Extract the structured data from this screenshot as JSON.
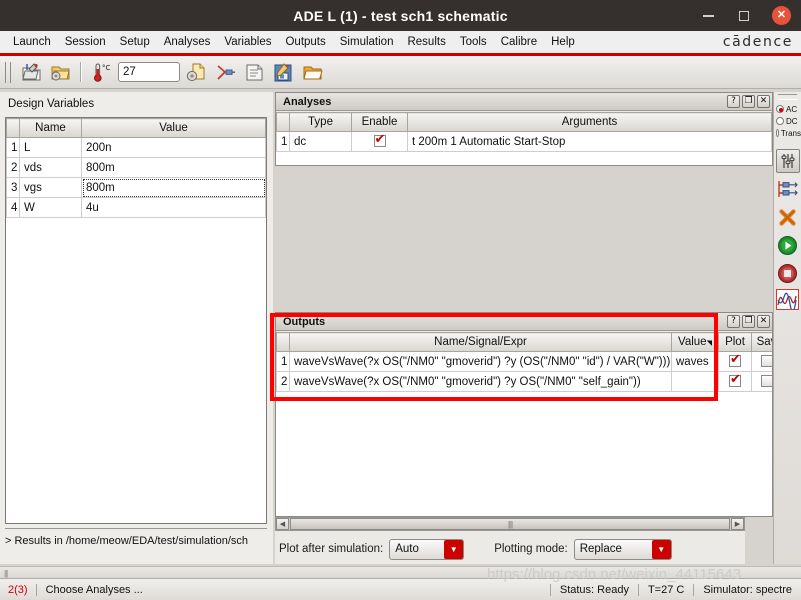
{
  "window": {
    "title": "ADE L (1) - test sch1 schematic",
    "minimize_label": "Minimize",
    "maximize_label": "Maximize",
    "close_label": "✕"
  },
  "menubar": {
    "items": [
      {
        "label": "Launch"
      },
      {
        "label": "Session"
      },
      {
        "label": "Setup"
      },
      {
        "label": "Analyses"
      },
      {
        "label": "Variables"
      },
      {
        "label": "Outputs"
      },
      {
        "label": "Simulation"
      },
      {
        "label": "Results"
      },
      {
        "label": "Tools"
      },
      {
        "label": "Calibre"
      },
      {
        "label": "Help"
      }
    ],
    "brand": "cādence"
  },
  "toolbar": {
    "temperature_value": "27",
    "temperature_unit": "°C",
    "icons": [
      "open-session-icon",
      "save-session-icon",
      "temperature-icon",
      "setup-simulation-icon",
      "netlist-icon",
      "results-icon",
      "edit-save-icon",
      "open-folder-icon"
    ]
  },
  "design_variables": {
    "title": "Design Variables",
    "columns": [
      "Name",
      "Value"
    ],
    "rows": [
      {
        "n": "1",
        "name": "L",
        "value": "200n",
        "selected": false
      },
      {
        "n": "2",
        "name": "vds",
        "value": "800m",
        "selected": false
      },
      {
        "n": "3",
        "name": "vgs",
        "value": "800m",
        "selected": true
      },
      {
        "n": "4",
        "name": "W",
        "value": "4u",
        "selected": false
      }
    ],
    "results_line": "> Results in /home/meow/EDA/test/simulation/sch"
  },
  "analyses": {
    "panel_title": "Analyses",
    "panel_buttons": [
      "?",
      "❐",
      "✕"
    ],
    "columns": [
      "Type",
      "Enable",
      "Arguments"
    ],
    "rows": [
      {
        "n": "1",
        "type": "dc",
        "enabled": true,
        "arguments": "t 200m 1 Automatic Start-Stop"
      }
    ]
  },
  "outputs": {
    "panel_title": "Outputs",
    "panel_buttons": [
      "?",
      "❐",
      "✕"
    ],
    "columns": [
      "Name/Signal/Expr",
      "Value",
      "Plot",
      "Sav"
    ],
    "rows": [
      {
        "n": "1",
        "expr": "waveVsWave(?x OS(\"/NM0\" \"gmoverid\") ?y (OS(\"/NM0\" \"id\") / VAR(\"W\")))",
        "value": "waves",
        "plot": true,
        "save": false
      },
      {
        "n": "2",
        "expr": "waveVsWave(?x OS(\"/NM0\" \"gmoverid\") ?y OS(\"/NM0\" \"self_gain\"))",
        "value": "",
        "plot": true,
        "save": false
      }
    ]
  },
  "plot_controls": {
    "plot_after_simulation_label": "Plot after simulation:",
    "plot_after_simulation_value": "Auto",
    "plotting_mode_label": "Plotting mode:",
    "plotting_mode_value": "Replace"
  },
  "rail": {
    "analysis_modes": [
      {
        "label": "AC",
        "selected": true
      },
      {
        "label": "DC",
        "selected": false
      },
      {
        "label": "Trans",
        "selected": false
      }
    ],
    "buttons": [
      "simulation-settings-icon",
      "netlist-and-run-icon",
      "delete-icon",
      "run-simulation-icon",
      "stop-simulation-icon",
      "plot-waveform-icon"
    ]
  },
  "statusbar": {
    "count": "2(3)",
    "message": "Choose Analyses ...",
    "status": "Status: Ready",
    "temperature": "T=27  C",
    "simulator": "Simulator: spectre"
  },
  "watermark": "https://blog.csdn.net/weixin_44115643",
  "colors": {
    "accent_red": "#cc0000",
    "title_bg": "#35302d",
    "close_btn": "#e8513a",
    "highlight_box": "#ff0000"
  }
}
